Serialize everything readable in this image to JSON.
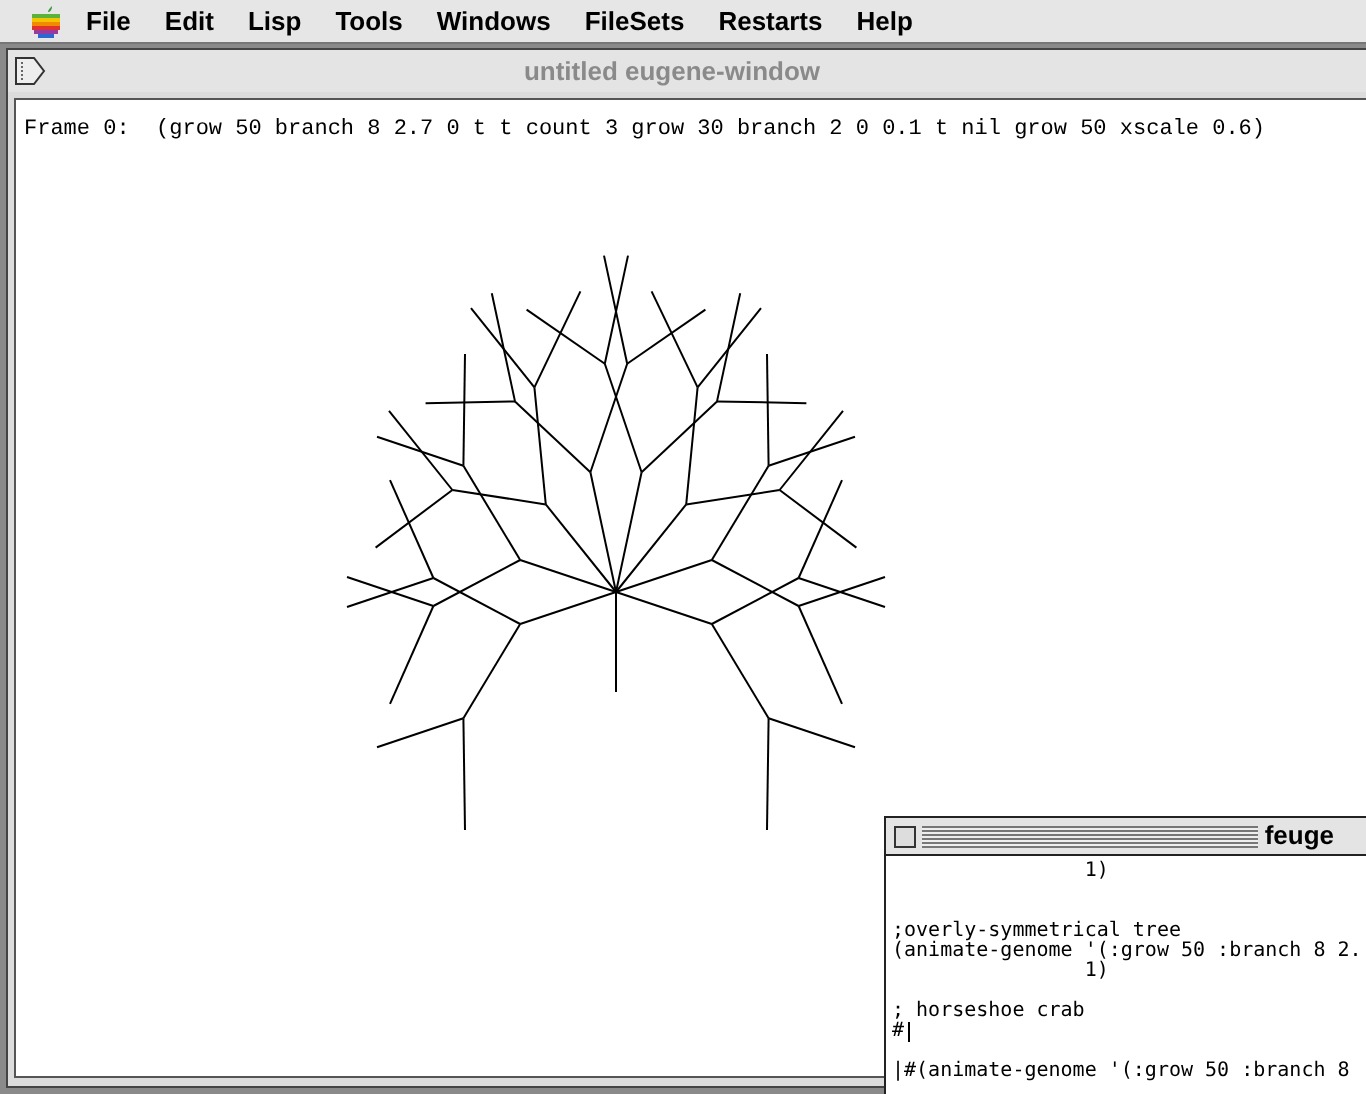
{
  "menu_bar": {
    "items": [
      "File",
      "Edit",
      "Lisp",
      "Tools",
      "Windows",
      "FileSets",
      "Restarts",
      "Help"
    ]
  },
  "main_window": {
    "title": "untitled eugene-window",
    "frame_label": "Frame 0:  (grow 50 branch 8 2.7 0 t t count 3 grow 30 branch 2 0 0.1 t nil grow 50 xscale 0.6)"
  },
  "listener_window": {
    "title": "feuge",
    "blocks": [
      [
        "                1)"
      ],
      [
        ";overly-symmetrical tree",
        "(animate-genome '(:grow 50 :branch 8 2.",
        "                1)"
      ],
      [
        "; horseshoe crab",
        "#"
      ],
      [
        "|#(animate-genome '(:grow 50 :branch 8"
      ]
    ]
  }
}
